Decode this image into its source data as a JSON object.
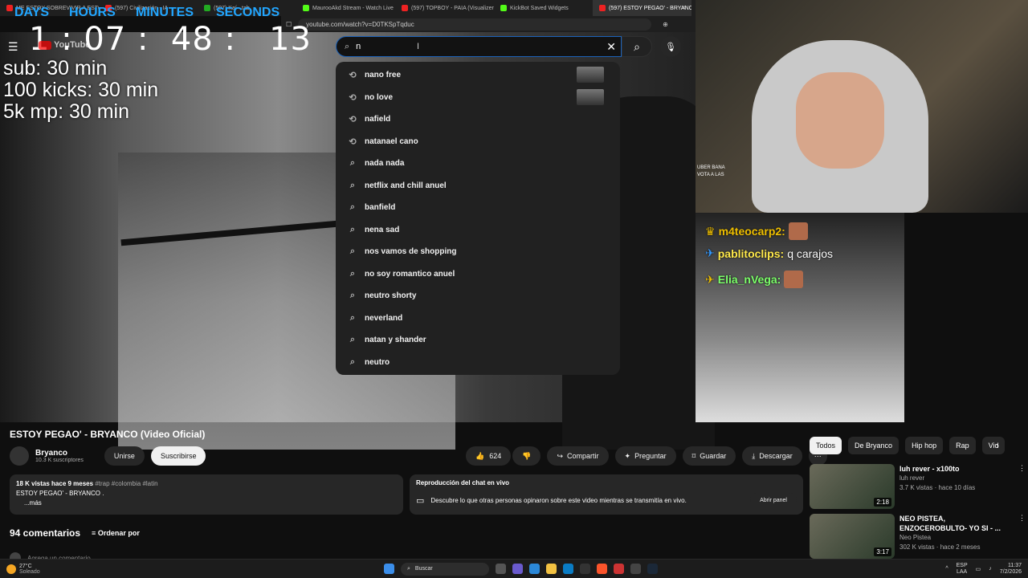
{
  "browser": {
    "tabs": [
      {
        "label": "ME ESTOY SOBREVIVIR A ESTO",
        "color": "#e22"
      },
      {
        "label": "(597) Civilización - IA",
        "color": "#e22"
      },
      {
        "label": "(597) Kaí - tab",
        "color": "#2a2"
      },
      {
        "label": "MaurooAkd Stream - Watch Live on",
        "color": "#53fc18"
      },
      {
        "label": "(597) TOPBOY - PAIA (Visualizer) #Tr",
        "color": "#e22"
      },
      {
        "label": "KickBot Saved Widgets",
        "color": "#53fc18"
      },
      {
        "label": "(597) ESTOY PEGAO' - BRYANCO",
        "color": "#e22"
      }
    ],
    "url": "youtube.com/watch?v=D0TKSpTqduc"
  },
  "timer": {
    "labels": [
      "DAYS",
      "HOURS",
      "MINUTES",
      "SECONDS"
    ],
    "value": "1 : 07 :  48 :   13"
  },
  "goals": [
    "sub: 30 min",
    "100 kicks: 30 min",
    "5k mp: 30 min"
  ],
  "youtube": {
    "logo": "YouTube",
    "search_value": "n",
    "suggestions": [
      {
        "text": "nano free",
        "icon": "history-icon",
        "thumb": true
      },
      {
        "text": "no love",
        "icon": "history-icon",
        "thumb": true
      },
      {
        "text": "nafield",
        "icon": "history-icon",
        "thumb": false
      },
      {
        "text": "natanael cano",
        "icon": "history-icon",
        "thumb": false
      },
      {
        "text": "nada nada",
        "icon": "search-icon",
        "thumb": false
      },
      {
        "text": "netflix and chill anuel",
        "icon": "search-icon",
        "thumb": false
      },
      {
        "text": "banfield",
        "icon": "search-icon",
        "thumb": false
      },
      {
        "text": "nena sad",
        "icon": "search-icon",
        "thumb": false
      },
      {
        "text": "nos vamos de shopping",
        "icon": "search-icon",
        "thumb": false
      },
      {
        "text": "no soy romantico anuel",
        "icon": "search-icon",
        "thumb": false
      },
      {
        "text": "neutro shorty",
        "icon": "search-icon",
        "thumb": false
      },
      {
        "text": "neverland",
        "icon": "search-icon",
        "thumb": false
      },
      {
        "text": "natan y shander",
        "icon": "search-icon",
        "thumb": false
      },
      {
        "text": "neutro",
        "icon": "search-icon",
        "thumb": false
      }
    ],
    "video_title": "ESTOY PEGAO' - BRYANCO (Video Oficial)",
    "channel": {
      "name": "Bryanco",
      "subs": "10.3 K suscriptores",
      "join": "Unirse",
      "subscribe": "Suscribirse"
    },
    "actions": {
      "likes": "624",
      "share": "Compartir",
      "ask": "Preguntar",
      "save": "Guardar",
      "download": "Descargar"
    },
    "description": {
      "meta": "18 K vistas  hace 9 meses",
      "tags": "#trap #colombia #latin",
      "text": "ESTOY PEGAO' - BRYANCO .",
      "more": "...más"
    },
    "live_chat": {
      "title": "Reproducción del chat en vivo",
      "text": "Descubre lo que otras personas opinaron sobre este video mientras se transmitía en vivo.",
      "button": "Abrir panel"
    },
    "comments": {
      "count": "94 comentarios",
      "sort": "Ordenar por",
      "placeholder": "Agrega un comentario..."
    },
    "chips": [
      "Todos",
      "De Bryanco",
      "Hip hop",
      "Rap",
      "Vid"
    ],
    "recommendations": [
      {
        "title": "luh rever - x100to",
        "channel": "luh rever",
        "meta": "3.7 K vistas · hace 10 días",
        "duration": "2:18"
      },
      {
        "title": "NEO PISTEA, ENZOCEROBULTO- YO SI - ...",
        "channel": "Neo Pistea",
        "meta": "302 K vistas · hace 2 meses",
        "duration": "3:17"
      }
    ]
  },
  "stream_chat": [
    {
      "user": "m4teocarp2:",
      "msg": "",
      "color": "#f0c000"
    },
    {
      "user": "pablitoclips:",
      "msg": "q carajos",
      "color": "#ffe94a"
    },
    {
      "user": "Elia_nVega:",
      "msg": "",
      "color": "#7cff6a"
    }
  ],
  "cam_chat": [
    "UBER BANA",
    "VOTA A LAS"
  ],
  "taskbar": {
    "weather_temp": "27°C",
    "weather_desc": "Soleado",
    "search": "Buscar",
    "lang": "ESP",
    "lang2": "LAA",
    "time": "11:37",
    "date": "7/2/2026"
  }
}
